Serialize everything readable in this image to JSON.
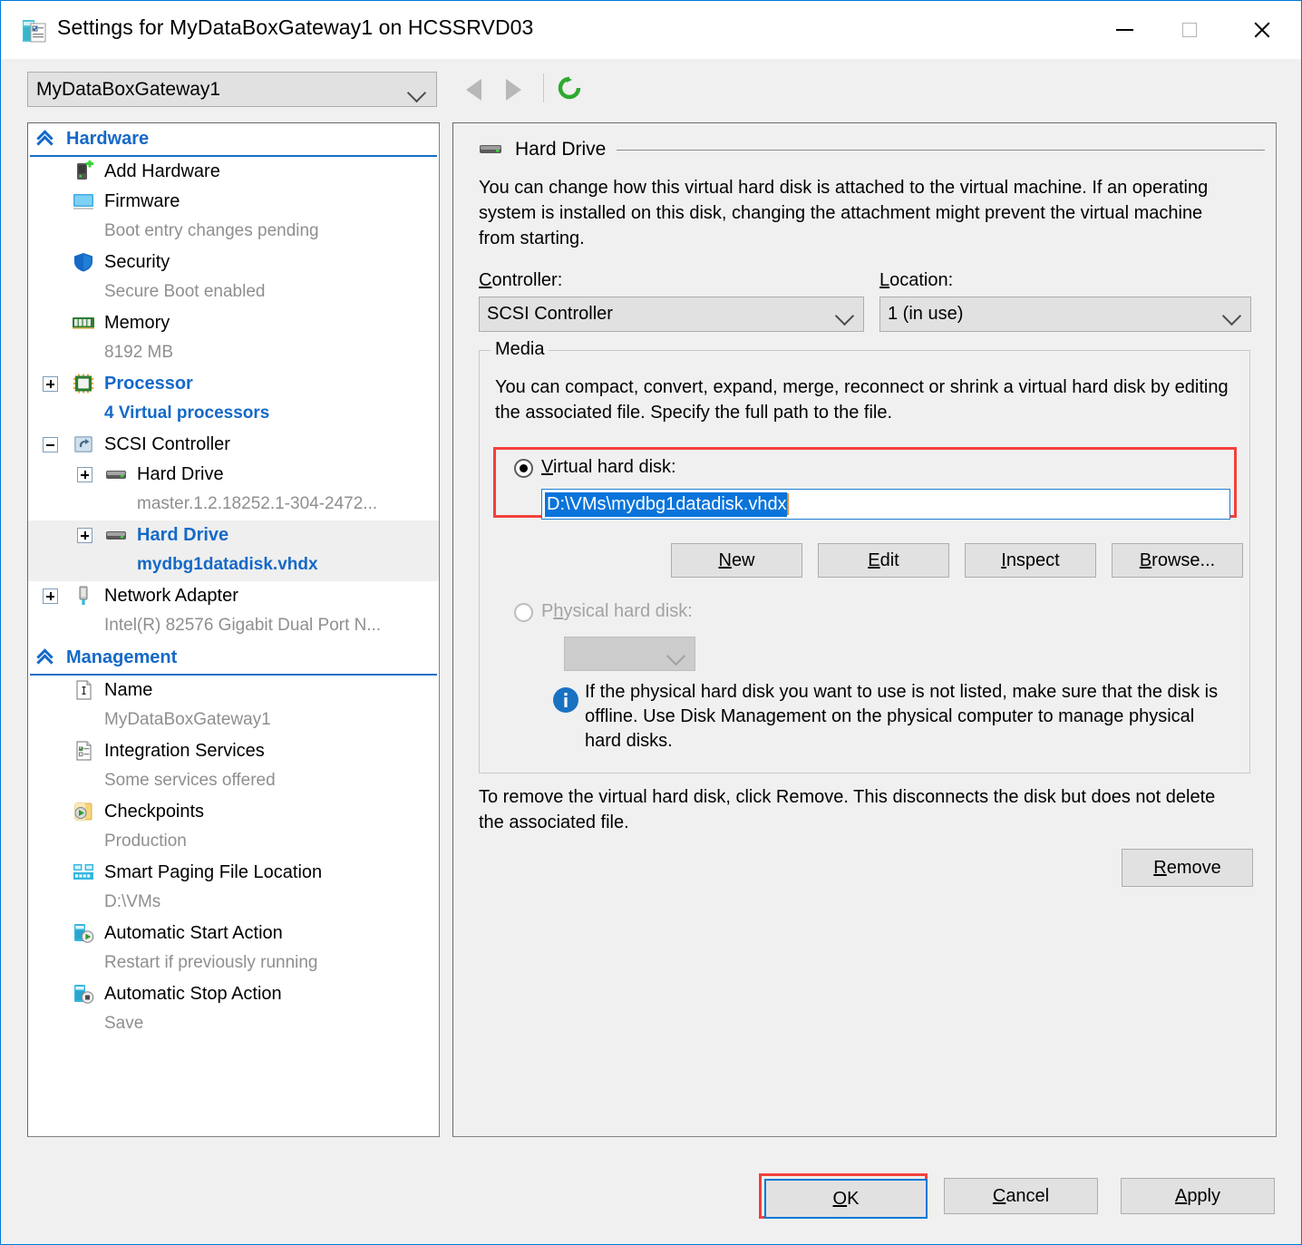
{
  "window": {
    "title": "Settings for MyDataBoxGateway1 on HCSSRVD03",
    "title_icon": "settings-vm-icon",
    "controls": {
      "minimize": "minimize-icon",
      "maximize": "maximize-icon",
      "close": "close-icon"
    }
  },
  "toolbar": {
    "vm_selected": "MyDataBoxGateway1",
    "back_icon": "back-arrow-icon",
    "forward_icon": "forward-arrow-icon",
    "refresh_icon": "refresh-icon"
  },
  "tree": {
    "sections": [
      {
        "title": "Hardware",
        "items": [
          {
            "label": "Add Hardware",
            "sub": "",
            "icon": "add-hardware-icon",
            "expander": "none",
            "selected": false,
            "highlight": false
          },
          {
            "label": "Firmware",
            "sub": "Boot entry changes pending",
            "icon": "firmware-icon",
            "expander": "none",
            "selected": false,
            "highlight": false
          },
          {
            "label": "Security",
            "sub": "Secure Boot enabled",
            "icon": "shield-icon",
            "expander": "none",
            "selected": false,
            "highlight": false
          },
          {
            "label": "Memory",
            "sub": "8192 MB",
            "icon": "memory-icon",
            "expander": "none",
            "selected": false,
            "highlight": false
          },
          {
            "label": "Processor",
            "sub": "4 Virtual processors",
            "icon": "processor-icon",
            "expander": "plus",
            "selected": false,
            "highlight": true
          },
          {
            "label": "SCSI Controller",
            "sub": "",
            "icon": "scsi-controller-icon",
            "expander": "minus",
            "selected": false,
            "highlight": false
          },
          {
            "label": "Hard Drive",
            "sub": "master.1.2.18252.1-304-2472...",
            "icon": "hard-drive-icon",
            "expander": "plus",
            "selected": false,
            "highlight": false,
            "indent": 1
          },
          {
            "label": "Hard Drive",
            "sub": "mydbg1datadisk.vhdx",
            "icon": "hard-drive-icon",
            "expander": "plus",
            "selected": true,
            "highlight": true,
            "indent": 1
          },
          {
            "label": "Network Adapter",
            "sub": "Intel(R) 82576 Gigabit Dual Port N...",
            "icon": "network-adapter-icon",
            "expander": "plus",
            "selected": false,
            "highlight": false
          }
        ]
      },
      {
        "title": "Management",
        "items": [
          {
            "label": "Name",
            "sub": "MyDataBoxGateway1",
            "icon": "name-icon",
            "expander": "none",
            "selected": false,
            "highlight": false
          },
          {
            "label": "Integration Services",
            "sub": "Some services offered",
            "icon": "integration-services-icon",
            "expander": "none",
            "selected": false,
            "highlight": false
          },
          {
            "label": "Checkpoints",
            "sub": "Production",
            "icon": "checkpoints-icon",
            "expander": "none",
            "selected": false,
            "highlight": false
          },
          {
            "label": "Smart Paging File Location",
            "sub": "D:\\VMs",
            "icon": "smart-paging-icon",
            "expander": "none",
            "selected": false,
            "highlight": false
          },
          {
            "label": "Automatic Start Action",
            "sub": "Restart if previously running",
            "icon": "auto-start-icon",
            "expander": "none",
            "selected": false,
            "highlight": false
          },
          {
            "label": "Automatic Stop Action",
            "sub": "Save",
            "icon": "auto-stop-icon",
            "expander": "none",
            "selected": false,
            "highlight": false
          }
        ]
      }
    ]
  },
  "panel": {
    "heading": "Hard Drive",
    "heading_icon": "hard-drive-icon",
    "description": "You can change how this virtual hard disk is attached to the virtual machine. If an operating system is installed on this disk, changing the attachment might prevent the virtual machine from starting.",
    "controller_label": "Controller:",
    "controller_value": "SCSI Controller",
    "location_label": "Location:",
    "location_value": "1 (in use)",
    "media": {
      "legend": "Media",
      "description": "You can compact, convert, expand, merge, reconnect or shrink a virtual hard disk by editing the associated file. Specify the full path to the file.",
      "virtual_hard_disk_label": "Virtual hard disk:",
      "virtual_hard_disk_value": "D:\\VMs\\mydbg1datadisk.vhdx",
      "virtual_hard_disk_selected": true,
      "buttons": {
        "new": "New",
        "edit": "Edit",
        "inspect": "Inspect",
        "browse": "Browse..."
      },
      "physical_hard_disk_label": "Physical hard disk:",
      "physical_hard_disk_value": "",
      "physical_disabled": true,
      "info_icon": "info-icon",
      "info_text": "If the physical hard disk you want to use is not listed, make sure that the disk is offline. Use Disk Management on the physical computer to manage physical hard disks."
    },
    "remove_description": "To remove the virtual hard disk, click Remove. This disconnects the disk but does not delete the associated file.",
    "remove_button": "Remove"
  },
  "footer": {
    "ok": "OK",
    "cancel": "Cancel",
    "apply": "Apply"
  },
  "colors": {
    "accent_blue": "#0078d7",
    "link_blue": "#1569c7",
    "highlight_red": "#f2413c",
    "selection_blue": "#0a74da",
    "caret_orange": "#e98d2a",
    "face": "#f0f0f0"
  }
}
